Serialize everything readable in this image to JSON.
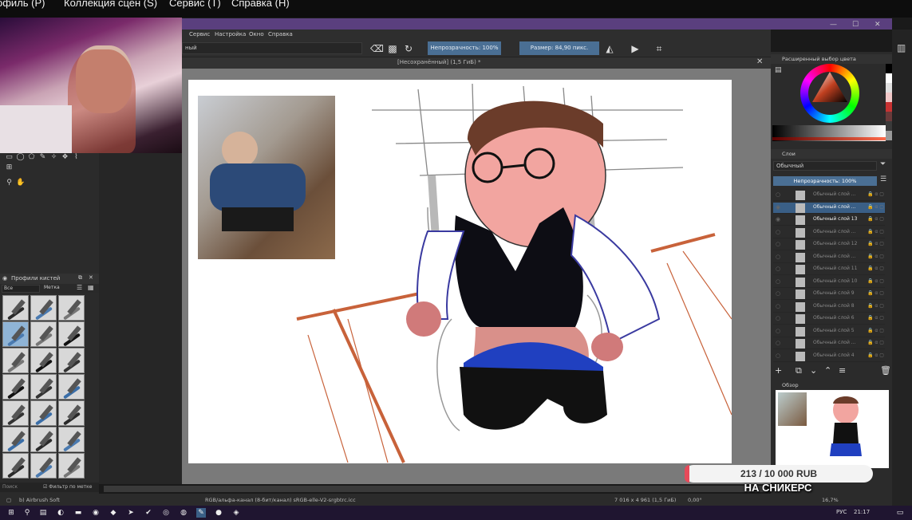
{
  "top_menu": {
    "profile": "офиль (P)",
    "scenes": "Коллекция сцен (S)",
    "service": "Сервис (T)",
    "help": "Справка (H)"
  },
  "window_controls": {
    "minimize": "—",
    "maximize": "☐",
    "close": "✕"
  },
  "menu": {
    "service": "Сервис",
    "settings": "Настройка",
    "window": "Окно",
    "help": "Справка"
  },
  "toolbar": {
    "brush_preset": "ный",
    "opacity": "Непрозрачность: 100%",
    "size": "Размер: 84,90 пикс."
  },
  "document_tab": {
    "title": "[Несохранённый]  (1,5 ГиБ) *",
    "close": "✕"
  },
  "brush_panel": {
    "title": "Профили кистей",
    "filter_all": "Все",
    "tag": "Метка",
    "search_placeholder": "Поиск",
    "filter_by_tag": "Фильтр по метке"
  },
  "color_panel": {
    "title": "Расширенный выбор цвета"
  },
  "layers_panel": {
    "title": "Слои",
    "blend_mode": "Обычный",
    "opacity": "Непрозрачность: 100%",
    "layers": [
      {
        "name": "Обычный слой ...",
        "visible": false,
        "selected": false
      },
      {
        "name": "Обычный слой ...",
        "visible": true,
        "selected": true
      },
      {
        "name": "Обычный слой 13",
        "visible": true,
        "selected": false
      },
      {
        "name": "Обычный слой ...",
        "visible": false,
        "selected": false
      },
      {
        "name": "Обычный слой 12",
        "visible": false,
        "selected": false
      },
      {
        "name": "Обычный слой ...",
        "visible": false,
        "selected": false
      },
      {
        "name": "Обычный слой 11",
        "visible": false,
        "selected": false
      },
      {
        "name": "Обычный слой 10",
        "visible": false,
        "selected": false
      },
      {
        "name": "Обычный слой 9",
        "visible": false,
        "selected": false
      },
      {
        "name": "Обычный слой 8",
        "visible": false,
        "selected": false
      },
      {
        "name": "Обычный слой 6",
        "visible": false,
        "selected": false
      },
      {
        "name": "Обычный слой 5",
        "visible": false,
        "selected": false
      },
      {
        "name": "Обычный слой ...",
        "visible": false,
        "selected": false
      },
      {
        "name": "Обычный слой 4",
        "visible": false,
        "selected": false
      }
    ]
  },
  "overview_panel": {
    "title": "Обзор"
  },
  "statusbar": {
    "brush": "b) Airbrush Soft",
    "color_profile": "RGB/альфа-канал (8-бит/канал)  sRGB-elle-V2-srgbtrc.icc",
    "dimensions": "7 016 x 4 961 (1,5 ГиБ)",
    "rotation": "0,00°",
    "zoom": "16,7%"
  },
  "taskbar": {
    "language": "РУС",
    "time": "21:17"
  },
  "donation": {
    "current": 213,
    "goal": 10000,
    "text": "213 / 10 000 RUB",
    "label": "НА СНИКЕРС",
    "fill_color": "#e74a5a"
  },
  "palette_colors": [
    "#000000",
    "#ffffff",
    "#e0e0e0",
    "#f0c8c8",
    "#c83232",
    "#6a3a3a",
    "#3a3a3a",
    "#9a9a9a"
  ]
}
